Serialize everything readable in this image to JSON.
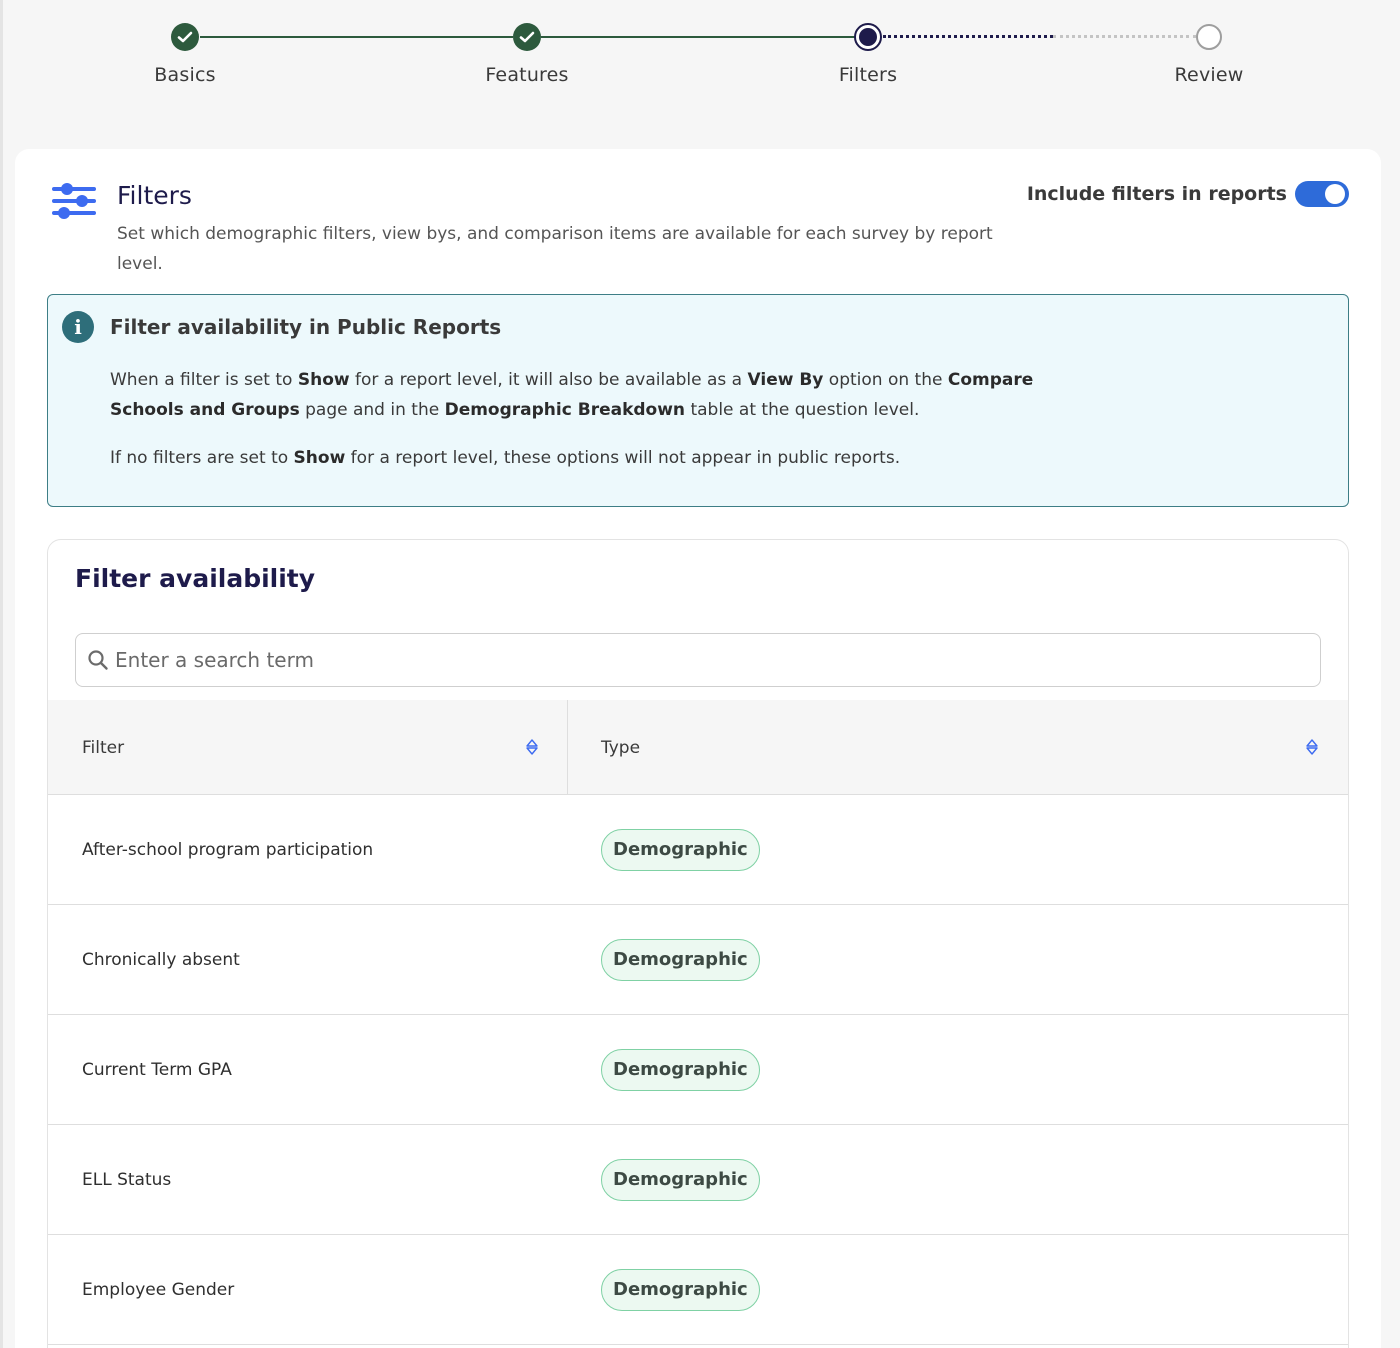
{
  "stepper": {
    "steps": [
      {
        "label": "Basics",
        "state": "complete"
      },
      {
        "label": "Features",
        "state": "complete"
      },
      {
        "label": "Filters",
        "state": "current"
      },
      {
        "label": "Review",
        "state": "upcoming"
      }
    ]
  },
  "header": {
    "icon": "sliders-icon",
    "title": "Filters",
    "description": "Set which demographic filters, view bys, and comparison items are available for each survey by report level.",
    "toggle_label": "Include filters in reports",
    "toggle_on": true
  },
  "info": {
    "icon": "info-icon",
    "title": "Filter availability in Public Reports",
    "p1": {
      "t1": "When a filter is set to ",
      "b1": "Show",
      "t2": " for a report level, it will also be available as a ",
      "b2": "View By",
      "t3": " option on the ",
      "b3": "Compare Schools and Groups",
      "t4": " page and in the ",
      "b4": "Demographic Breakdown",
      "t5": " table at the question level."
    },
    "p2": {
      "t1": "If no filters are set to ",
      "b1": "Show",
      "t2": " for a report level, these options will not appear in public reports."
    }
  },
  "table": {
    "title": "Filter availability",
    "search_placeholder": "Enter a search term",
    "columns": [
      {
        "label": "Filter",
        "sort_icon": "sort-icon"
      },
      {
        "label": "Type",
        "sort_icon": "sort-icon"
      }
    ],
    "rows": [
      {
        "filter": "After-school program participation",
        "type": "Demographic"
      },
      {
        "filter": "Chronically absent",
        "type": "Demographic"
      },
      {
        "filter": "Current Term GPA",
        "type": "Demographic"
      },
      {
        "filter": "ELL Status",
        "type": "Demographic"
      },
      {
        "filter": "Employee Gender",
        "type": "Demographic"
      }
    ]
  },
  "colors": {
    "complete": "#2d5a3d",
    "current": "#1e1b4b",
    "toggle": "#2e6bd9",
    "info_bg": "#edf9fc",
    "info_border": "#3d7e86",
    "badge_bg": "#ecf9f1",
    "badge_border": "#7fd1a4"
  }
}
